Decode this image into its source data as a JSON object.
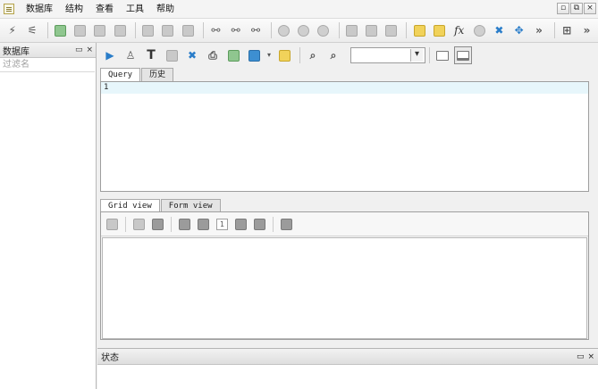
{
  "menu": [
    "数据库",
    "结构",
    "查看",
    "工具",
    "帮助"
  ],
  "window": {
    "restore_glyph": "▫",
    "max_glyph": "⧉",
    "close_glyph": "×"
  },
  "toolbar1": {
    "overflow_1": "»",
    "overflow_2": "»"
  },
  "left_panel": {
    "title": "数据库",
    "float_glyph": "▭",
    "close_glyph": "×",
    "filter_placeholder": "过滤名"
  },
  "toolbar2": {
    "select_value": ""
  },
  "query_tabs": [
    "Query",
    "历史"
  ],
  "editor": {
    "line_number": "1"
  },
  "grid_tabs": [
    "Grid view",
    "Form view"
  ],
  "grid_toolbar": {
    "page_number": "1"
  },
  "status_panel": {
    "title": "状态",
    "float_glyph": "▭",
    "close_glyph": "×"
  }
}
